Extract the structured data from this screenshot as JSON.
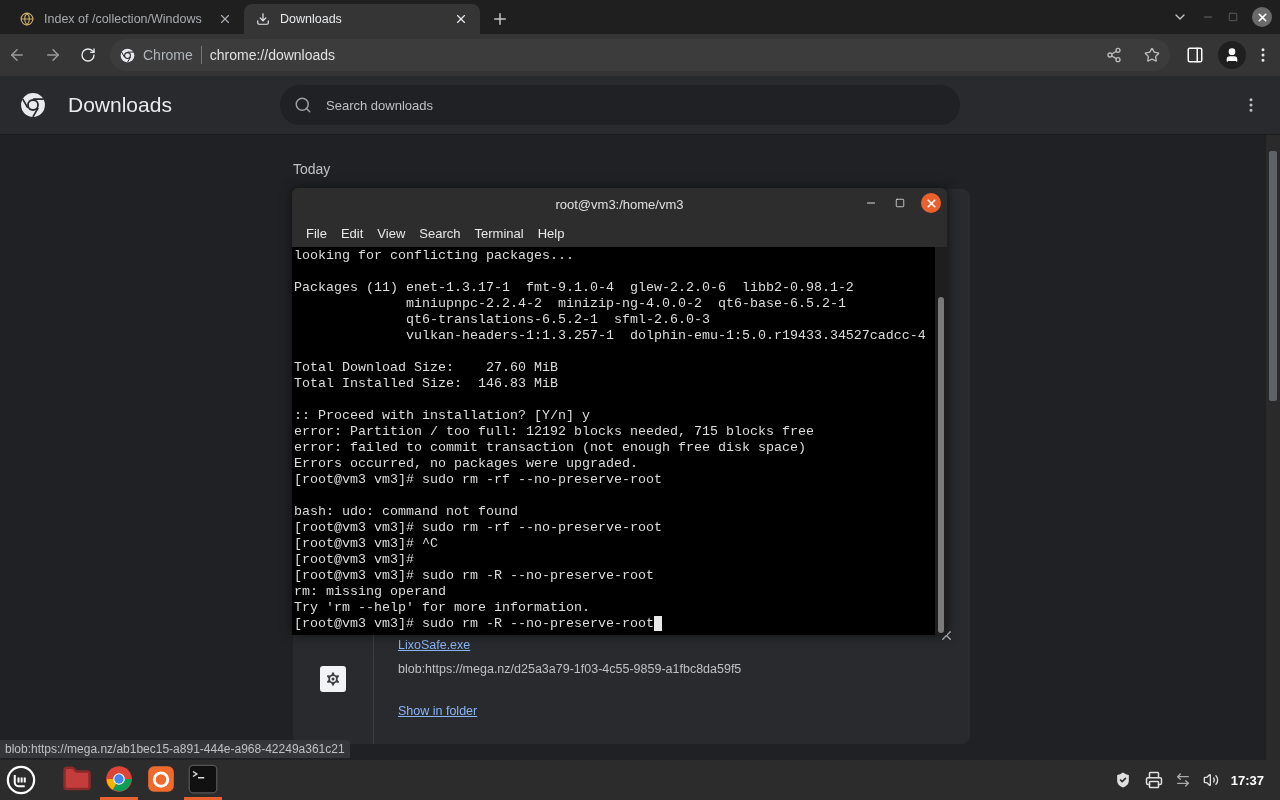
{
  "browser": {
    "tabs": [
      {
        "title": "Index of /collection/Windows",
        "selected": false
      },
      {
        "title": "Downloads",
        "selected": true
      }
    ],
    "omnibox": {
      "chip": "Chrome",
      "url": "chrome://downloads"
    }
  },
  "page": {
    "title": "Downloads",
    "search": {
      "placeholder": "Search downloads"
    },
    "date_heading": "Today",
    "download": {
      "file_name": "LixoSafe.exe",
      "source": "blob:https://mega.nz/d25a3a79-1f03-4c55-9859-a1fbc8da59f5",
      "action": "Show in folder"
    }
  },
  "status_bubble": "blob:https://mega.nz/ab1bec15-a891-444e-a968-42249a361c21",
  "terminal": {
    "title": "root@vm3:/home/vm3",
    "menu": [
      "File",
      "Edit",
      "View",
      "Search",
      "Terminal",
      "Help"
    ],
    "blocks": [
      [
        "looking for conflicting packages..."
      ],
      [
        "Packages (11) enet-1.3.17-1  fmt-9.1.0-4  glew-2.2.0-6  libb2-0.98.1-2",
        "              miniupnpc-2.2.4-2  minizip-ng-4.0.0-2  qt6-base-6.5.2-1",
        "              qt6-translations-6.5.2-1  sfml-2.6.0-3",
        "              vulkan-headers-1:1.3.257-1  dolphin-emu-1:5.0.r19433.34527cadcc-4"
      ],
      [
        "Total Download Size:    27.60 MiB",
        "Total Installed Size:  146.83 MiB"
      ],
      [
        ":: Proceed with installation? [Y/n] y",
        "error: Partition / too full: 12192 blocks needed, 715 blocks free",
        "error: failed to commit transaction (not enough free disk space)",
        "Errors occurred, no packages were upgraded.",
        "[root@vm3 vm3]# sudo rm -rf --no-preserve-root"
      ],
      [
        "bash: udo: command not found",
        "[root@vm3 vm3]# sudo rm -rf --no-preserve-root",
        "[root@vm3 vm3]# ^C",
        "[root@vm3 vm3]#",
        "[root@vm3 vm3]# sudo rm -R --no-preserve-root",
        "rm: missing operand",
        "Try 'rm --help' for more information.",
        "[root@vm3 vm3]# sudo rm -R --no-preserve-root"
      ]
    ]
  },
  "taskbar": {
    "apps": [
      {
        "kind": "files",
        "running": false
      },
      {
        "kind": "chrome",
        "running": true
      },
      {
        "kind": "firefox",
        "running": false
      },
      {
        "kind": "terminal",
        "running": true
      }
    ],
    "clock": "17:37"
  }
}
